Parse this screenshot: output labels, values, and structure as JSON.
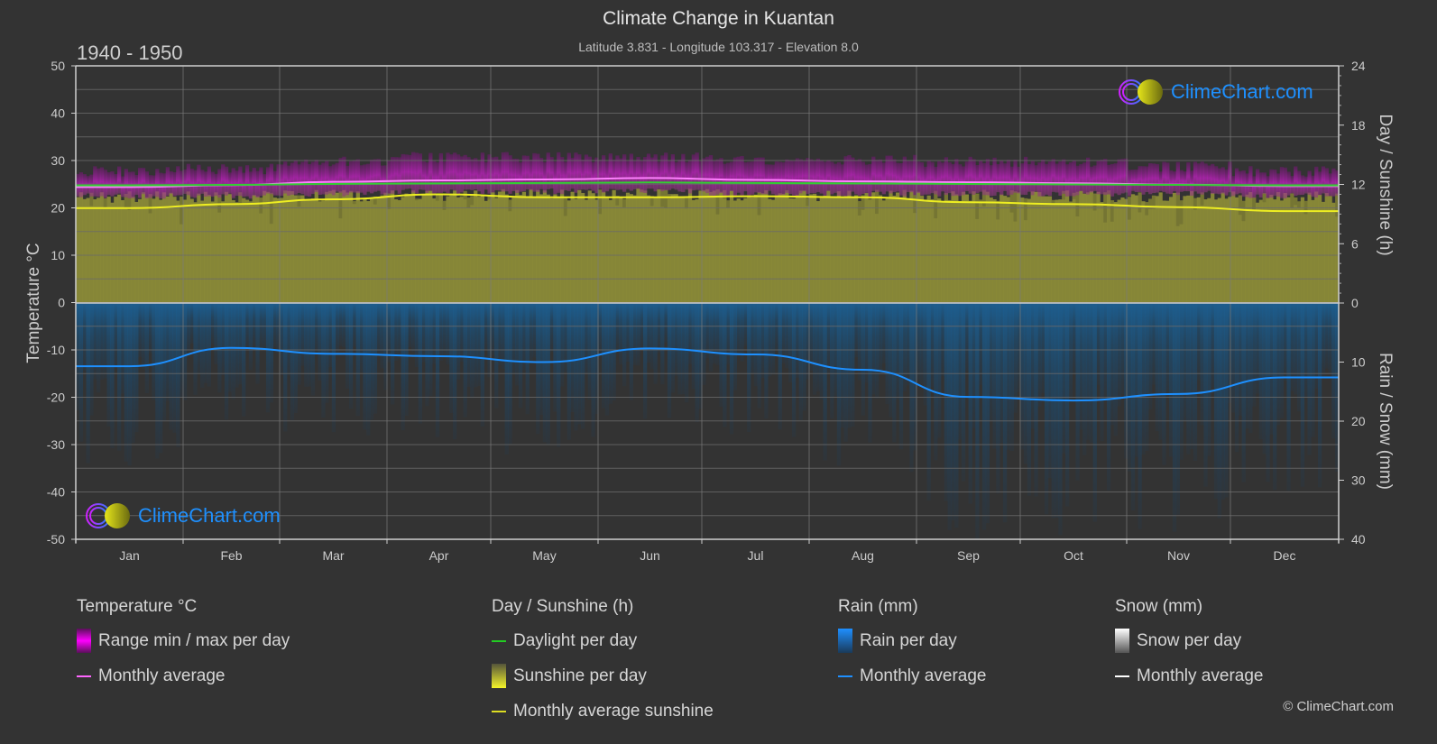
{
  "header": {
    "title": "Climate Change in Kuantan",
    "subtitle": "Latitude 3.831 - Longitude 103.317 - Elevation 8.0",
    "period": "1940 - 1950"
  },
  "logo": {
    "text": "ClimeChart.com"
  },
  "copyright": "© ClimeChart.com",
  "colors": {
    "background": "#333333",
    "temp_range": "#c020c0",
    "temp_avg": "#ff70ff",
    "daylight": "#33cc33",
    "sunshine_fill": "#8f8f3a",
    "sunshine_avg": "#eeee22",
    "rain_fill": "#1a5a8a",
    "rain_avg": "#1e90ff",
    "snow_avg": "#ffffff"
  },
  "legend": {
    "groups": [
      {
        "title": "Temperature °C",
        "items": [
          {
            "label": "Range min / max per day",
            "type": "bar",
            "swatch": "temp-range"
          },
          {
            "label": "Monthly average",
            "type": "line",
            "swatch": "temp-avg"
          }
        ]
      },
      {
        "title": "Day / Sunshine (h)",
        "items": [
          {
            "label": "Daylight per day",
            "type": "line",
            "swatch": "daylight"
          },
          {
            "label": "Sunshine per day",
            "type": "bar",
            "swatch": "sunshine"
          },
          {
            "label": "Monthly average sunshine",
            "type": "line",
            "swatch": "sunshine-avg"
          }
        ]
      },
      {
        "title": "Rain (mm)",
        "items": [
          {
            "label": "Rain per day",
            "type": "bar",
            "swatch": "rain"
          },
          {
            "label": "Monthly average",
            "type": "line",
            "swatch": "rain-avg"
          }
        ]
      },
      {
        "title": "Snow (mm)",
        "items": [
          {
            "label": "Snow per day",
            "type": "bar",
            "swatch": "snow"
          },
          {
            "label": "Monthly average",
            "type": "line",
            "swatch": "snow-avg"
          }
        ]
      }
    ]
  },
  "chart_data": {
    "type": "area",
    "title": "Climate Change in Kuantan",
    "subtitle": "Latitude 3.831 - Longitude 103.317 - Elevation 8.0",
    "categories": [
      "Jan",
      "Feb",
      "Mar",
      "Apr",
      "May",
      "Jun",
      "Jul",
      "Aug",
      "Sep",
      "Oct",
      "Nov",
      "Dec"
    ],
    "left_axis": {
      "label": "Temperature °C",
      "range": [
        -50,
        50
      ],
      "ticks": [
        "50",
        "40",
        "30",
        "20",
        "10",
        "0",
        "-10",
        "-20",
        "-30",
        "-40",
        "-50"
      ]
    },
    "right_axis_top": {
      "label": "Day / Sunshine (h)",
      "range": [
        0,
        24
      ],
      "ticks": [
        "24",
        "18",
        "12",
        "6",
        "0"
      ]
    },
    "right_axis_bottom": {
      "label": "Rain / Snow (mm)",
      "range": [
        0,
        40
      ],
      "ticks": [
        "0",
        "10",
        "20",
        "30",
        "40"
      ]
    },
    "grid": true,
    "series": [
      {
        "name": "Temperature range max (approx)",
        "unit": "°C",
        "values": [
          27.5,
          28.0,
          29.5,
          30.5,
          30.5,
          30.5,
          30.0,
          30.0,
          29.5,
          29.5,
          28.5,
          27.5
        ]
      },
      {
        "name": "Temperature range min (approx)",
        "unit": "°C",
        "values": [
          22.5,
          22.5,
          23.0,
          23.5,
          23.5,
          23.5,
          23.0,
          23.0,
          23.0,
          23.0,
          23.0,
          22.5
        ]
      },
      {
        "name": "Temperature monthly average",
        "unit": "°C",
        "values": [
          24.4,
          24.8,
          25.5,
          25.8,
          26.0,
          26.3,
          25.9,
          25.6,
          25.4,
          25.2,
          24.9,
          24.6
        ]
      },
      {
        "name": "Daylight per day",
        "unit": "h",
        "values": [
          11.9,
          11.95,
          12.05,
          12.1,
          12.15,
          12.2,
          12.15,
          12.1,
          12.05,
          12.0,
          11.95,
          11.9
        ]
      },
      {
        "name": "Monthly average sunshine",
        "unit": "h",
        "values": [
          9.6,
          10.0,
          10.5,
          11.0,
          10.7,
          10.7,
          10.8,
          10.7,
          10.2,
          10.0,
          9.7,
          9.3
        ]
      },
      {
        "name": "Rain monthly average",
        "unit": "mm",
        "values": [
          10.7,
          7.6,
          8.6,
          9.0,
          10.0,
          7.7,
          8.7,
          11.3,
          15.9,
          16.5,
          15.4,
          12.6
        ]
      },
      {
        "name": "Snow monthly average",
        "unit": "mm",
        "values": [
          0,
          0,
          0,
          0,
          0,
          0,
          0,
          0,
          0,
          0,
          0,
          0
        ]
      }
    ],
    "legend_position": "bottom"
  }
}
